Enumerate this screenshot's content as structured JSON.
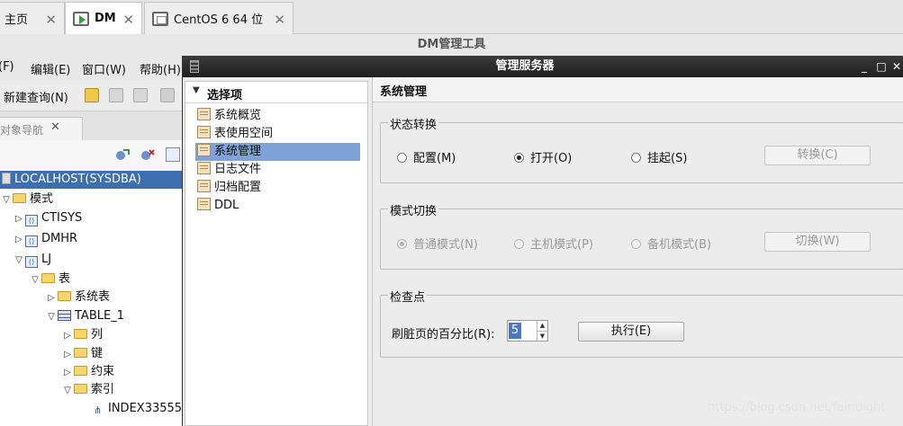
{
  "host_tabs": [
    {
      "label": "主页",
      "icon": "home-tab"
    },
    {
      "label": "DM",
      "icon": "vm-green-icon"
    },
    {
      "label": "CentOS 6 64 位",
      "icon": "vm-icon"
    }
  ],
  "app_title": "DM管理工具",
  "menu": [
    "(F)",
    "编辑(E)",
    "窗口(W)",
    "帮助(H)"
  ],
  "toolbar": {
    "new_query": "新建查询(N)"
  },
  "nav_tab": {
    "label": "对象导航",
    "close": "✕"
  },
  "tree": {
    "root": "LOCALHOST(SYSDBA)",
    "schema": "模式",
    "ctisys": "CTISYS",
    "dmhr": "DMHR",
    "lj": "LJ",
    "table_folder": "表",
    "sys_table": "系统表",
    "table1": "TABLE_1",
    "col": "列",
    "key": "键",
    "constraint": "约束",
    "index": "索引",
    "index_item": "INDEX33555"
  },
  "dialog": {
    "title": "管理服务器",
    "options_header": "选择项",
    "options": [
      "系统概览",
      "表使用空间",
      "系统管理",
      "日志文件",
      "归档配置",
      "DDL"
    ],
    "selected_option": "系统管理",
    "panel_title": "系统管理",
    "status_group": {
      "title": "状态转换",
      "radios": [
        "配置(M)",
        "打开(O)",
        "挂起(S)"
      ],
      "selected": "打开(O)",
      "button": "转换(C)"
    },
    "mode_group": {
      "title": "模式切换",
      "radios": [
        "普通模式(N)",
        "主机模式(P)",
        "备机模式(B)"
      ],
      "selected": "普通模式(N)",
      "button": "切换(W)"
    },
    "checkpoint_group": {
      "title": "检查点",
      "label": "刷脏页的百分比(R):",
      "value": "5",
      "button": "执行(E)"
    }
  },
  "watermark": "https://blog.csdn.net/faintlight",
  "colors": {
    "selection": "#3d6fb0",
    "option_selection": "#7fa3d6",
    "titlebar": "#2a2a2a"
  }
}
